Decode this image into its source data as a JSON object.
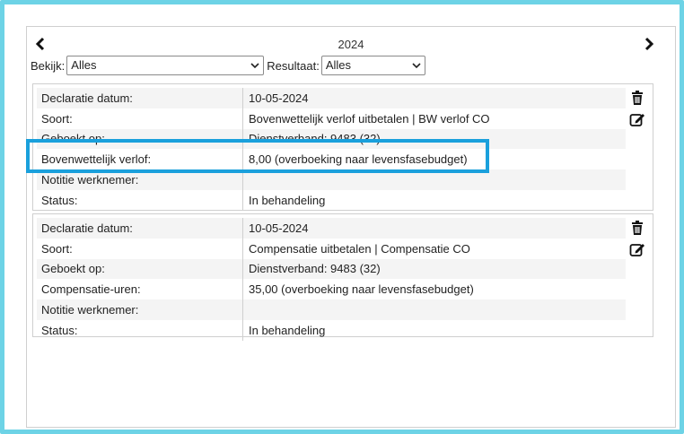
{
  "nav": {
    "year": "2024",
    "prev_icon": "chevron-left-icon",
    "next_icon": "chevron-right-icon"
  },
  "filters": {
    "bekijk_label": "Bekijk:",
    "bekijk_value": "Alles",
    "resultaat_label": "Resultaat:",
    "resultaat_value": "Alles"
  },
  "records": [
    {
      "rows": [
        {
          "label": "Declaratie datum:",
          "value": "10-05-2024"
        },
        {
          "label": "Soort:",
          "value": "Bovenwettelijk verlof uitbetalen | BW verlof CO"
        },
        {
          "label": "Geboekt op:",
          "value": "Dienstverband: 9483 (32)"
        },
        {
          "label": "Bovenwettelijk verlof:",
          "value": "8,00 (overboeking naar levensfasebudget)"
        },
        {
          "label": "Notitie werknemer:",
          "value": ""
        },
        {
          "label": "Status:",
          "value": "In behandeling"
        }
      ]
    },
    {
      "rows": [
        {
          "label": "Declaratie datum:",
          "value": "10-05-2024"
        },
        {
          "label": "Soort:",
          "value": "Compensatie uitbetalen | Compensatie CO"
        },
        {
          "label": "Geboekt op:",
          "value": "Dienstverband: 9483 (32)"
        },
        {
          "label": "Compensatie-uren:",
          "value": "35,00 (overboeking naar levensfasebudget)"
        },
        {
          "label": "Notitie werknemer:",
          "value": ""
        },
        {
          "label": "Status:",
          "value": "In behandeling"
        }
      ]
    }
  ],
  "colors": {
    "frame": "#6dd3e6",
    "highlight": "#1aa0dc",
    "row_alt": "#f4f4f4"
  }
}
